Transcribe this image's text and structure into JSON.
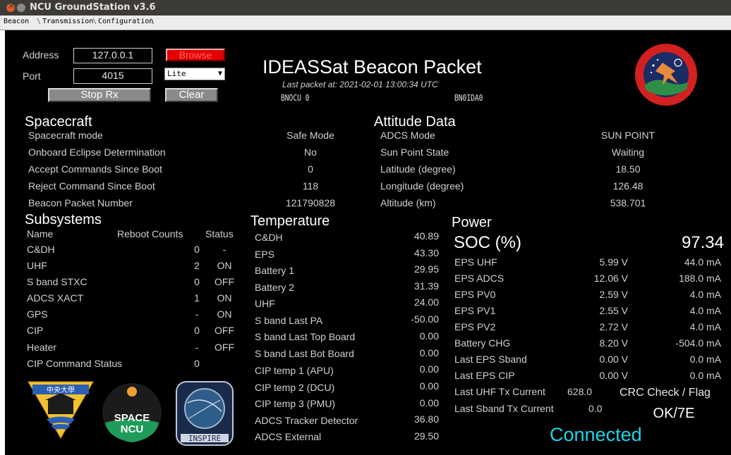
{
  "window": {
    "title": "NCU GroundStation v3.6"
  },
  "tabs": [
    "Beacon",
    "Transmission",
    "Configuration"
  ],
  "controls": {
    "address_label": "Address",
    "address_value": "127.0.0.1",
    "port_label": "Port",
    "port_value": "4015",
    "browse_label": "Browse",
    "mode_select": "Lite",
    "stop_label": "Stop Rx",
    "clear_label": "Clear"
  },
  "header": {
    "title": "IDEASSat Beacon Packet",
    "last_packet": "Last packet at: 2021-02-01 13:00:34 UTC",
    "call_from": "BNOCU 0",
    "call_to": "BN0IDA0"
  },
  "spacecraft": {
    "title": "Spacecraft",
    "rows": [
      {
        "label": "Spacecraft mode",
        "value": "Safe Mode"
      },
      {
        "label": "Onboard Eclipse Determination",
        "value": "No"
      },
      {
        "label": "Accept Commands Since Boot",
        "value": "0"
      },
      {
        "label": "Reject Command Since Boot",
        "value": "118"
      },
      {
        "label": "Beacon Packet Number",
        "value": "121790828"
      }
    ]
  },
  "attitude": {
    "title": "Attitude Data",
    "rows": [
      {
        "label": "ADCS Mode",
        "value": "SUN POINT"
      },
      {
        "label": "Sun Point State",
        "value": "Waiting"
      },
      {
        "label": "Latitude (degree)",
        "value": "18.50"
      },
      {
        "label": "Longitude (degree)",
        "value": "126.48"
      },
      {
        "label": "Altitude (km)",
        "value": "538.701"
      }
    ]
  },
  "subsystems": {
    "title": "Subsystems",
    "col_name": "Name",
    "col_reboot": "Reboot Counts",
    "col_status": "Status",
    "rows": [
      {
        "name": "C&DH",
        "reboot": "0",
        "status": "-"
      },
      {
        "name": "UHF",
        "reboot": "2",
        "status": "ON"
      },
      {
        "name": "S band STXC",
        "reboot": "0",
        "status": "OFF"
      },
      {
        "name": "ADCS XACT",
        "reboot": "1",
        "status": "ON"
      },
      {
        "name": "GPS",
        "reboot": "-",
        "status": "ON"
      },
      {
        "name": "CIP",
        "reboot": "0",
        "status": "OFF"
      },
      {
        "name": "Heater",
        "reboot": "-",
        "status": "OFF"
      },
      {
        "name": "CIP Command Status",
        "reboot": "0",
        "status": ""
      }
    ]
  },
  "temperature": {
    "title": "Temperature",
    "rows": [
      {
        "label": "C&DH",
        "value": "40.89"
      },
      {
        "label": "EPS",
        "value": "43.30"
      },
      {
        "label": "Battery 1",
        "value": "29.95"
      },
      {
        "label": "Battery 2",
        "value": "31.39"
      },
      {
        "label": "UHF",
        "value": "24.00"
      },
      {
        "label": "S band Last PA",
        "value": "-50.00"
      },
      {
        "label": "S band Last Top Board",
        "value": "0.00"
      },
      {
        "label": "S band Last Bot Board",
        "value": "0.00"
      },
      {
        "label": "CIP temp 1 (APU)",
        "value": "0.00"
      },
      {
        "label": "CIP temp 2 (DCU)",
        "value": "0.00"
      },
      {
        "label": "CIP temp 3 (PMU)",
        "value": "0.00"
      },
      {
        "label": "ADCS Tracker Detector",
        "value": "36.80"
      },
      {
        "label": "ADCS External",
        "value": "29.50"
      }
    ]
  },
  "power": {
    "title": "Power",
    "soc_label": "SOC (%)",
    "soc_value": "97.34",
    "rows": [
      {
        "label": "EPS UHF",
        "voltage": "5.99 V",
        "current": "44.0 mA"
      },
      {
        "label": "EPS ADCS",
        "voltage": "12.06 V",
        "current": "188.0 mA"
      },
      {
        "label": "EPS PV0",
        "voltage": "2.59 V",
        "current": "4.0 mA"
      },
      {
        "label": "EPS PV1",
        "voltage": "2.55 V",
        "current": "4.0 mA"
      },
      {
        "label": "EPS PV2",
        "voltage": "2.72 V",
        "current": "4.0 mA"
      },
      {
        "label": "Battery CHG",
        "voltage": "8.20 V",
        "current": "-504.0 mA"
      },
      {
        "label": "Last EPS Sband",
        "voltage": "0.00 V",
        "current": "0.0 mA"
      },
      {
        "label": "Last EPS CIP",
        "voltage": "0.00 V",
        "current": "0.0 mA"
      }
    ],
    "uhf_tx_label": "Last UHF Tx Current",
    "uhf_tx_value": "628.0",
    "sband_tx_label": "Last Sband Tx Current",
    "sband_tx_value": "0.0",
    "crc_label": "CRC Check / Flag",
    "crc_value": "OK/7E",
    "status": "Connected"
  },
  "logos": {
    "top_right": "IDEASSat",
    "space_ncu": "SPACE NCU",
    "inspire": "INSPIRE"
  },
  "colors": {
    "background": "#000000",
    "text": "#d0d0d0",
    "connected": "#1fd3e8",
    "browse": "#e40000"
  }
}
